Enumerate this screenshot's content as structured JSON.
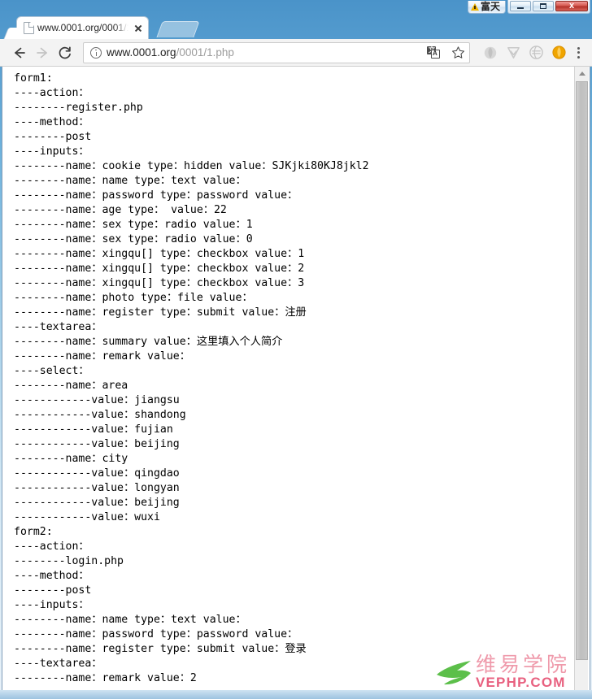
{
  "window": {
    "badge_label": "富天",
    "badge_icon": "warning-triangle-icon",
    "minimize_label": "Minimize",
    "maximize_label": "Maximize",
    "close_label": "x"
  },
  "tabs": [
    {
      "title": "www.0001.org/0001/1",
      "favicon": "page-icon",
      "close_label": "Close tab"
    }
  ],
  "newtab": {
    "label": "New tab"
  },
  "toolbar": {
    "back_label": "Back",
    "forward_label": "Forward",
    "reload_label": "Reload",
    "info_icon": "info-circle-icon",
    "url_host": "www.0001.org",
    "url_path": "/0001/1.php",
    "url_full": "www.0001.org/0001/1.php",
    "translate_icon": "translate-icon",
    "translate_front_text": "A",
    "translate_back_text": "文",
    "bookmark_icon": "star-icon",
    "extensions": [
      {
        "name": "extension-icon-1"
      },
      {
        "name": "extension-icon-2"
      },
      {
        "name": "extension-icon-3"
      },
      {
        "name": "extension-icon-4"
      }
    ],
    "menu_icon": "three-dot-menu-icon"
  },
  "page": {
    "lines": [
      "form1:",
      "----action：",
      "--------register.php",
      "----method：",
      "--------post",
      "----inputs：",
      "--------name：cookie type：hidden value：SJKjki80KJ8jkl2",
      "--------name：name type：text value：",
      "--------name：password type：password value：",
      "--------name：age type： value：22",
      "--------name：sex type：radio value：1",
      "--------name：sex type：radio value：0",
      "--------name：xingqu[] type：checkbox value：1",
      "--------name：xingqu[] type：checkbox value：2",
      "--------name：xingqu[] type：checkbox value：3",
      "--------name：photo type：file value：",
      "--------name：register type：submit value：注册",
      "----textarea：",
      "--------name：summary value：这里填入个人简介",
      "--------name：remark value：",
      "----select：",
      "--------name：area",
      "------------value：jiangsu",
      "------------value：shandong",
      "------------value：fujian",
      "------------value：beijing",
      "--------name：city",
      "------------value：qingdao",
      "------------value：longyan",
      "------------value：beijing",
      "------------value：wuxi",
      "form2:",
      "----action：",
      "--------login.php",
      "----method：",
      "--------post",
      "----inputs：",
      "--------name：name type：text value：",
      "--------name：password type：password value：",
      "--------name：register type：submit value：登录",
      "----textarea：",
      "--------name：remark value：2"
    ]
  },
  "watermark": {
    "cn_text": "维易学院",
    "en_text": "VEPHP.COM",
    "leaf_icon": "green-leaf-logo",
    "cn_color": "#ef9aab",
    "en_color": "#e8607f",
    "leaf_color": "#5cbf4a"
  },
  "scrollbar": {
    "up_arrow": "scroll-up-arrow",
    "down_arrow": "scroll-down-arrow"
  }
}
